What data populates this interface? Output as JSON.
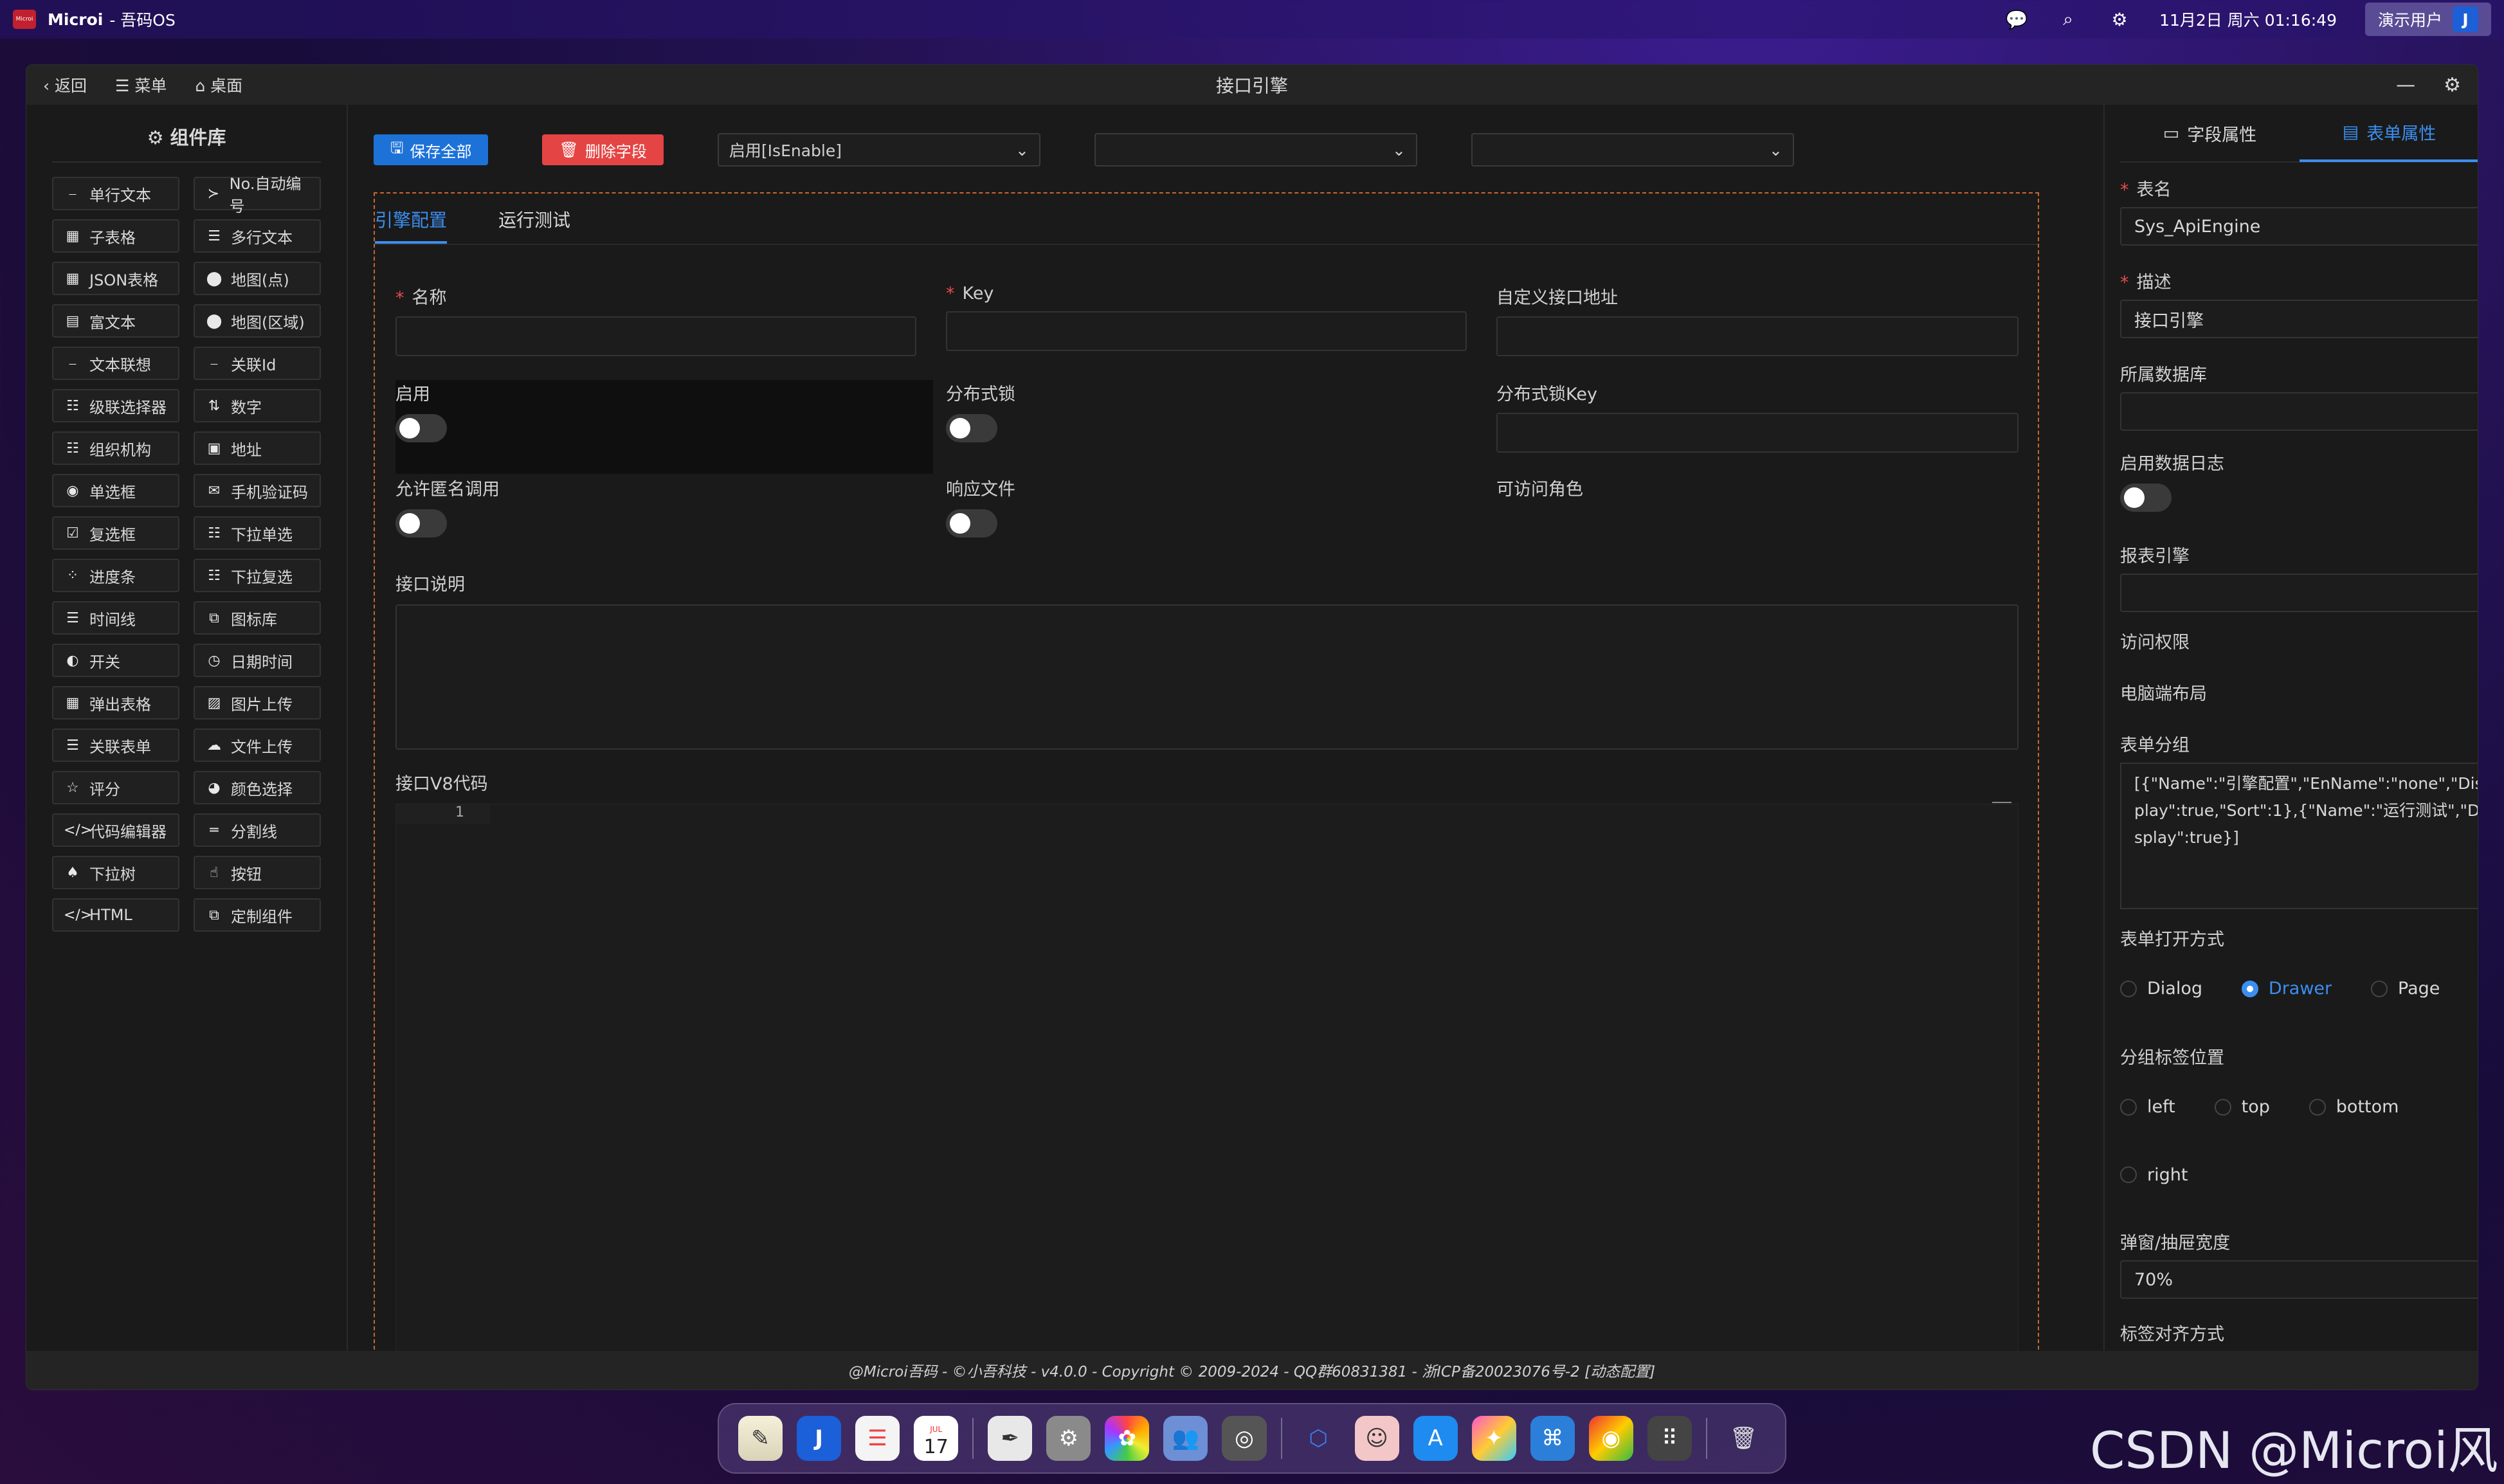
{
  "topbar": {
    "app_name": "Microi",
    "app_suffix": " - 吾码OS",
    "datetime": "11月2日 周六 01:16:49",
    "user": "演示用户",
    "logo_text": "Microi"
  },
  "window": {
    "back": "返回",
    "menu": "菜单",
    "desktop": "桌面",
    "title": "接口引擎"
  },
  "components": {
    "title": "组件库",
    "items": [
      {
        "icon": "underline-icon",
        "glyph": "⎯",
        "label": "单行文本"
      },
      {
        "icon": "terminal-icon",
        "glyph": "≻",
        "label": "No.自动编号"
      },
      {
        "icon": "table-icon",
        "glyph": "▦",
        "label": "子表格"
      },
      {
        "icon": "lines-icon",
        "glyph": "☰",
        "label": "多行文本"
      },
      {
        "icon": "table-icon",
        "glyph": "▦",
        "label": "JSON表格"
      },
      {
        "icon": "map-pin-icon",
        "glyph": "⬤",
        "label": "地图(点)"
      },
      {
        "icon": "rich-text-icon",
        "glyph": "▤",
        "label": "富文本"
      },
      {
        "icon": "map-pin-icon",
        "glyph": "⬤",
        "label": "地图(区域)"
      },
      {
        "icon": "underline-icon",
        "glyph": "⎯",
        "label": "文本联想"
      },
      {
        "icon": "underline-icon",
        "glyph": "⎯",
        "label": "关联Id"
      },
      {
        "icon": "list-icon",
        "glyph": "☷",
        "label": "级联选择器"
      },
      {
        "icon": "sort-numeric-icon",
        "glyph": "⇅",
        "label": "数字"
      },
      {
        "icon": "list-icon",
        "glyph": "☷",
        "label": "组织机构"
      },
      {
        "icon": "address-card-icon",
        "glyph": "▣",
        "label": "地址"
      },
      {
        "icon": "radio-icon",
        "glyph": "◉",
        "label": "单选框"
      },
      {
        "icon": "sms-icon",
        "glyph": "✉",
        "label": "手机验证码"
      },
      {
        "icon": "checkbox-icon",
        "glyph": "☑",
        "label": "复选框"
      },
      {
        "icon": "list-icon",
        "glyph": "☷",
        "label": "下拉单选"
      },
      {
        "icon": "spinner-icon",
        "glyph": "⁘",
        "label": "进度条"
      },
      {
        "icon": "list-check-icon",
        "glyph": "☷",
        "label": "下拉复选"
      },
      {
        "icon": "timeline-icon",
        "glyph": "☰",
        "label": "时间线"
      },
      {
        "icon": "icons-icon",
        "glyph": "⧉",
        "label": "图标库"
      },
      {
        "icon": "toggle-icon",
        "glyph": "◐",
        "label": "开关"
      },
      {
        "icon": "clock-icon",
        "glyph": "◷",
        "label": "日期时间"
      },
      {
        "icon": "table-icon",
        "glyph": "▦",
        "label": "弹出表格"
      },
      {
        "icon": "image-icon",
        "glyph": "▨",
        "label": "图片上传"
      },
      {
        "icon": "form-list-icon",
        "glyph": "☰",
        "label": "关联表单"
      },
      {
        "icon": "cloud-upload-icon",
        "glyph": "☁",
        "label": "文件上传"
      },
      {
        "icon": "star-icon",
        "glyph": "☆",
        "label": "评分"
      },
      {
        "icon": "palette-icon",
        "glyph": "◕",
        "label": "颜色选择"
      },
      {
        "icon": "code-icon",
        "glyph": "</>",
        "label": "代码编辑器"
      },
      {
        "icon": "divider-icon",
        "glyph": "═",
        "label": "分割线"
      },
      {
        "icon": "tree-icon",
        "glyph": "♠",
        "label": "下拉树"
      },
      {
        "icon": "hand-pointer-icon",
        "glyph": "☝",
        "label": "按钮"
      },
      {
        "icon": "code-icon",
        "glyph": "</>",
        "label": "HTML"
      },
      {
        "icon": "custom-icon",
        "glyph": "⧉",
        "label": "定制组件"
      }
    ]
  },
  "toolbar": {
    "save_all": "保存全部",
    "delete_field": "删除字段",
    "select1": "启用[IsEnable]",
    "select2": "",
    "select3": ""
  },
  "form": {
    "tabs": [
      "引擎配置",
      "运行测试"
    ],
    "fields": {
      "name": "名称",
      "key": "Key",
      "custom_url": "自定义接口地址",
      "enable": "启用",
      "dist_lock": "分布式锁",
      "dist_lock_key": "分布式锁Key",
      "anon": "允许匿名调用",
      "resp_file": "响应文件",
      "roles": "可访问角色",
      "desc": "接口说明",
      "code": "接口V8代码"
    },
    "code_line": "1"
  },
  "right": {
    "tab_field": "字段属性",
    "tab_form": "表单属性",
    "table_name_label": "表名",
    "table_name": "Sys_ApiEngine",
    "desc_label": "描述",
    "desc": "接口引擎",
    "db_label": "所属数据库",
    "log_label": "启用数据日志",
    "report_label": "报表引擎",
    "access_label": "访问权限",
    "pc_layout_label": "电脑端布局",
    "group_label": "表单分组",
    "group_value": "[{\"Name\":\"引擎配置\",\"EnName\":\"none\",\"Display\":true,\"Sort\":1},{\"Name\":\"运行测试\",\"Display\":true}]",
    "open_label": "表单打开方式",
    "open_opts": [
      "Dialog",
      "Drawer",
      "Page"
    ],
    "tabpos_label": "分组标签位置",
    "tabpos_opts": [
      "left",
      "top",
      "bottom",
      "right"
    ],
    "width_label": "弹窗/抽屉宽度",
    "width": "70%",
    "align_label": "标签对齐方式"
  },
  "footer": "@Microi吾码 - ©小吾科技 - v4.0.0 - Copyright © 2009-2024 - QQ群60831381 - 浙ICP备20023076号-2 [动态配置]",
  "watermark": "CSDN @Microi风闲",
  "dock": [
    "notes-icon",
    "microi-icon",
    "reminders-icon",
    "calendar-icon",
    "textedit-icon",
    "settings-icon",
    "photos-icon",
    "contacts-icon",
    "system-prefs-icon",
    "cube-icon",
    "avatar-icon",
    "appstore-icon",
    "design-icon",
    "network-icon",
    "chrome-icon",
    "launchpad-icon",
    "trash-icon"
  ],
  "dock_calendar_day": "17",
  "dock_calendar_month": "JUL"
}
